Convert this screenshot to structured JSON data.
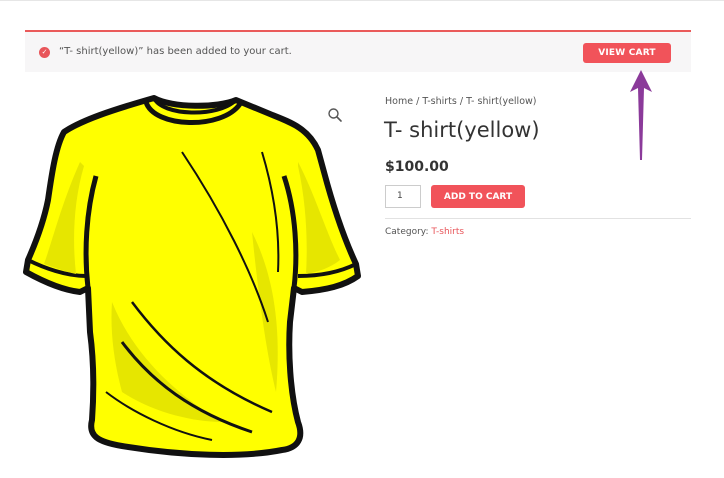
{
  "notice": {
    "message": "“T- shirt(yellow)” has been added to your cart.",
    "icon": "check-circle-icon",
    "view_cart_label": "VIEW CART"
  },
  "annotation": {
    "arrow_icon": "up-arrow-icon",
    "arrow_color": "#8b3a9a"
  },
  "breadcrumb": {
    "home": "Home",
    "sep1": " / ",
    "category": "T-shirts",
    "sep2": " / ",
    "current": "T- shirt(yellow)"
  },
  "product": {
    "title": "T- shirt(yellow)",
    "price": "$100.00",
    "quantity": "1",
    "add_to_cart_label": "ADD TO CART",
    "category_label": "Category: ",
    "category_link": "T-shirts",
    "image_icon": "yellow-tshirt-image",
    "zoom_icon": "magnifier-icon"
  },
  "colors": {
    "accent": "#f1535a",
    "shirt_fill": "#ffff00",
    "shirt_shade": "#e6e600",
    "outline": "#111111"
  }
}
